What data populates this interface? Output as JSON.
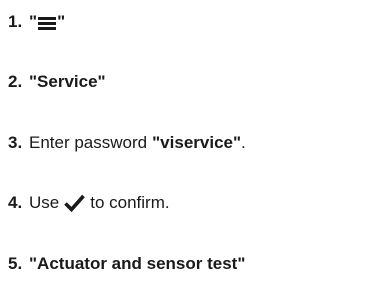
{
  "steps": [
    {
      "number": "1.",
      "quote_open": "\"",
      "icon": "menu-icon",
      "quote_close": "\""
    },
    {
      "number": "2.",
      "text": "\"Service\""
    },
    {
      "number": "3.",
      "text_before": "Enter password",
      "bold": "\"viservice\"",
      "text_after": "."
    },
    {
      "number": "4.",
      "text_before": "Use",
      "icon": "check-icon",
      "text_after": "to confirm."
    },
    {
      "number": "5.",
      "text": "\"Actuator and sensor test\""
    }
  ],
  "colors": {
    "text": "#1a1a1a"
  }
}
